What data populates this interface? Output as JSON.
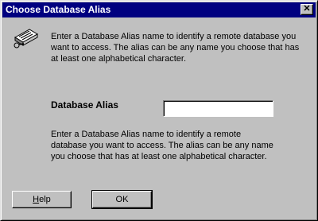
{
  "window": {
    "title": "Choose Database Alias",
    "close_label": "✕"
  },
  "content": {
    "intro": "Enter a Database Alias name to identify a remote database you want to access.  The alias can be any name you choose that has at least one alphabetical character.",
    "field_label": "Database Alias",
    "field_value": "",
    "help_text": "Enter a Database Alias name to identify a remote database you want to access.  The alias can be any name you choose that has at least one alphabetical character."
  },
  "buttons": {
    "help_mnemonic": "H",
    "help_rest": "elp",
    "ok_label": "OK"
  },
  "icons": {
    "header_icon": "database-key-icon",
    "close_icon": "close-icon"
  }
}
